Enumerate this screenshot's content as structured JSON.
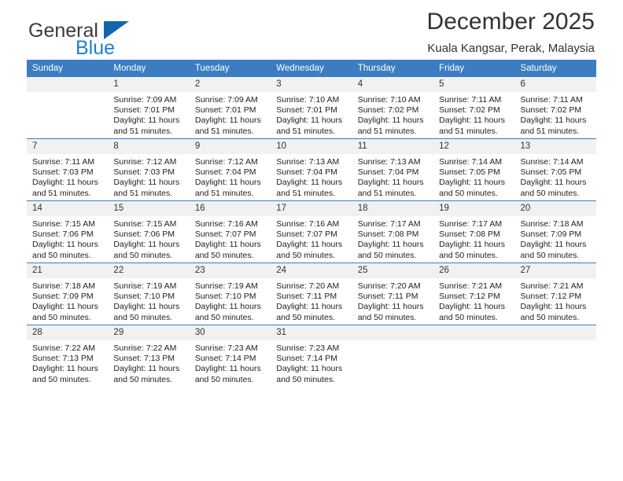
{
  "brand": {
    "name_part1": "General",
    "name_part2": "Blue",
    "flag_icon": "triangle-flag-icon"
  },
  "header": {
    "month_title": "December 2025",
    "location": "Kuala Kangsar, Perak, Malaysia"
  },
  "colors": {
    "header_blue": "#3b7dc0",
    "brand_blue": "#1b7fd4",
    "flag_blue": "#1464ab",
    "daynum_band": "#f1f1f1"
  },
  "weekdays": [
    "Sunday",
    "Monday",
    "Tuesday",
    "Wednesday",
    "Thursday",
    "Friday",
    "Saturday"
  ],
  "weeks": [
    [
      {
        "day": "",
        "sunrise": "",
        "sunset": "",
        "daylight1": "",
        "daylight2": ""
      },
      {
        "day": "1",
        "sunrise": "Sunrise: 7:09 AM",
        "sunset": "Sunset: 7:01 PM",
        "daylight1": "Daylight: 11 hours",
        "daylight2": "and 51 minutes."
      },
      {
        "day": "2",
        "sunrise": "Sunrise: 7:09 AM",
        "sunset": "Sunset: 7:01 PM",
        "daylight1": "Daylight: 11 hours",
        "daylight2": "and 51 minutes."
      },
      {
        "day": "3",
        "sunrise": "Sunrise: 7:10 AM",
        "sunset": "Sunset: 7:01 PM",
        "daylight1": "Daylight: 11 hours",
        "daylight2": "and 51 minutes."
      },
      {
        "day": "4",
        "sunrise": "Sunrise: 7:10 AM",
        "sunset": "Sunset: 7:02 PM",
        "daylight1": "Daylight: 11 hours",
        "daylight2": "and 51 minutes."
      },
      {
        "day": "5",
        "sunrise": "Sunrise: 7:11 AM",
        "sunset": "Sunset: 7:02 PM",
        "daylight1": "Daylight: 11 hours",
        "daylight2": "and 51 minutes."
      },
      {
        "day": "6",
        "sunrise": "Sunrise: 7:11 AM",
        "sunset": "Sunset: 7:02 PM",
        "daylight1": "Daylight: 11 hours",
        "daylight2": "and 51 minutes."
      }
    ],
    [
      {
        "day": "7",
        "sunrise": "Sunrise: 7:11 AM",
        "sunset": "Sunset: 7:03 PM",
        "daylight1": "Daylight: 11 hours",
        "daylight2": "and 51 minutes."
      },
      {
        "day": "8",
        "sunrise": "Sunrise: 7:12 AM",
        "sunset": "Sunset: 7:03 PM",
        "daylight1": "Daylight: 11 hours",
        "daylight2": "and 51 minutes."
      },
      {
        "day": "9",
        "sunrise": "Sunrise: 7:12 AM",
        "sunset": "Sunset: 7:04 PM",
        "daylight1": "Daylight: 11 hours",
        "daylight2": "and 51 minutes."
      },
      {
        "day": "10",
        "sunrise": "Sunrise: 7:13 AM",
        "sunset": "Sunset: 7:04 PM",
        "daylight1": "Daylight: 11 hours",
        "daylight2": "and 51 minutes."
      },
      {
        "day": "11",
        "sunrise": "Sunrise: 7:13 AM",
        "sunset": "Sunset: 7:04 PM",
        "daylight1": "Daylight: 11 hours",
        "daylight2": "and 51 minutes."
      },
      {
        "day": "12",
        "sunrise": "Sunrise: 7:14 AM",
        "sunset": "Sunset: 7:05 PM",
        "daylight1": "Daylight: 11 hours",
        "daylight2": "and 50 minutes."
      },
      {
        "day": "13",
        "sunrise": "Sunrise: 7:14 AM",
        "sunset": "Sunset: 7:05 PM",
        "daylight1": "Daylight: 11 hours",
        "daylight2": "and 50 minutes."
      }
    ],
    [
      {
        "day": "14",
        "sunrise": "Sunrise: 7:15 AM",
        "sunset": "Sunset: 7:06 PM",
        "daylight1": "Daylight: 11 hours",
        "daylight2": "and 50 minutes."
      },
      {
        "day": "15",
        "sunrise": "Sunrise: 7:15 AM",
        "sunset": "Sunset: 7:06 PM",
        "daylight1": "Daylight: 11 hours",
        "daylight2": "and 50 minutes."
      },
      {
        "day": "16",
        "sunrise": "Sunrise: 7:16 AM",
        "sunset": "Sunset: 7:07 PM",
        "daylight1": "Daylight: 11 hours",
        "daylight2": "and 50 minutes."
      },
      {
        "day": "17",
        "sunrise": "Sunrise: 7:16 AM",
        "sunset": "Sunset: 7:07 PM",
        "daylight1": "Daylight: 11 hours",
        "daylight2": "and 50 minutes."
      },
      {
        "day": "18",
        "sunrise": "Sunrise: 7:17 AM",
        "sunset": "Sunset: 7:08 PM",
        "daylight1": "Daylight: 11 hours",
        "daylight2": "and 50 minutes."
      },
      {
        "day": "19",
        "sunrise": "Sunrise: 7:17 AM",
        "sunset": "Sunset: 7:08 PM",
        "daylight1": "Daylight: 11 hours",
        "daylight2": "and 50 minutes."
      },
      {
        "day": "20",
        "sunrise": "Sunrise: 7:18 AM",
        "sunset": "Sunset: 7:09 PM",
        "daylight1": "Daylight: 11 hours",
        "daylight2": "and 50 minutes."
      }
    ],
    [
      {
        "day": "21",
        "sunrise": "Sunrise: 7:18 AM",
        "sunset": "Sunset: 7:09 PM",
        "daylight1": "Daylight: 11 hours",
        "daylight2": "and 50 minutes."
      },
      {
        "day": "22",
        "sunrise": "Sunrise: 7:19 AM",
        "sunset": "Sunset: 7:10 PM",
        "daylight1": "Daylight: 11 hours",
        "daylight2": "and 50 minutes."
      },
      {
        "day": "23",
        "sunrise": "Sunrise: 7:19 AM",
        "sunset": "Sunset: 7:10 PM",
        "daylight1": "Daylight: 11 hours",
        "daylight2": "and 50 minutes."
      },
      {
        "day": "24",
        "sunrise": "Sunrise: 7:20 AM",
        "sunset": "Sunset: 7:11 PM",
        "daylight1": "Daylight: 11 hours",
        "daylight2": "and 50 minutes."
      },
      {
        "day": "25",
        "sunrise": "Sunrise: 7:20 AM",
        "sunset": "Sunset: 7:11 PM",
        "daylight1": "Daylight: 11 hours",
        "daylight2": "and 50 minutes."
      },
      {
        "day": "26",
        "sunrise": "Sunrise: 7:21 AM",
        "sunset": "Sunset: 7:12 PM",
        "daylight1": "Daylight: 11 hours",
        "daylight2": "and 50 minutes."
      },
      {
        "day": "27",
        "sunrise": "Sunrise: 7:21 AM",
        "sunset": "Sunset: 7:12 PM",
        "daylight1": "Daylight: 11 hours",
        "daylight2": "and 50 minutes."
      }
    ],
    [
      {
        "day": "28",
        "sunrise": "Sunrise: 7:22 AM",
        "sunset": "Sunset: 7:13 PM",
        "daylight1": "Daylight: 11 hours",
        "daylight2": "and 50 minutes."
      },
      {
        "day": "29",
        "sunrise": "Sunrise: 7:22 AM",
        "sunset": "Sunset: 7:13 PM",
        "daylight1": "Daylight: 11 hours",
        "daylight2": "and 50 minutes."
      },
      {
        "day": "30",
        "sunrise": "Sunrise: 7:23 AM",
        "sunset": "Sunset: 7:14 PM",
        "daylight1": "Daylight: 11 hours",
        "daylight2": "and 50 minutes."
      },
      {
        "day": "31",
        "sunrise": "Sunrise: 7:23 AM",
        "sunset": "Sunset: 7:14 PM",
        "daylight1": "Daylight: 11 hours",
        "daylight2": "and 50 minutes."
      },
      {
        "day": "",
        "sunrise": "",
        "sunset": "",
        "daylight1": "",
        "daylight2": ""
      },
      {
        "day": "",
        "sunrise": "",
        "sunset": "",
        "daylight1": "",
        "daylight2": ""
      },
      {
        "day": "",
        "sunrise": "",
        "sunset": "",
        "daylight1": "",
        "daylight2": ""
      }
    ]
  ]
}
